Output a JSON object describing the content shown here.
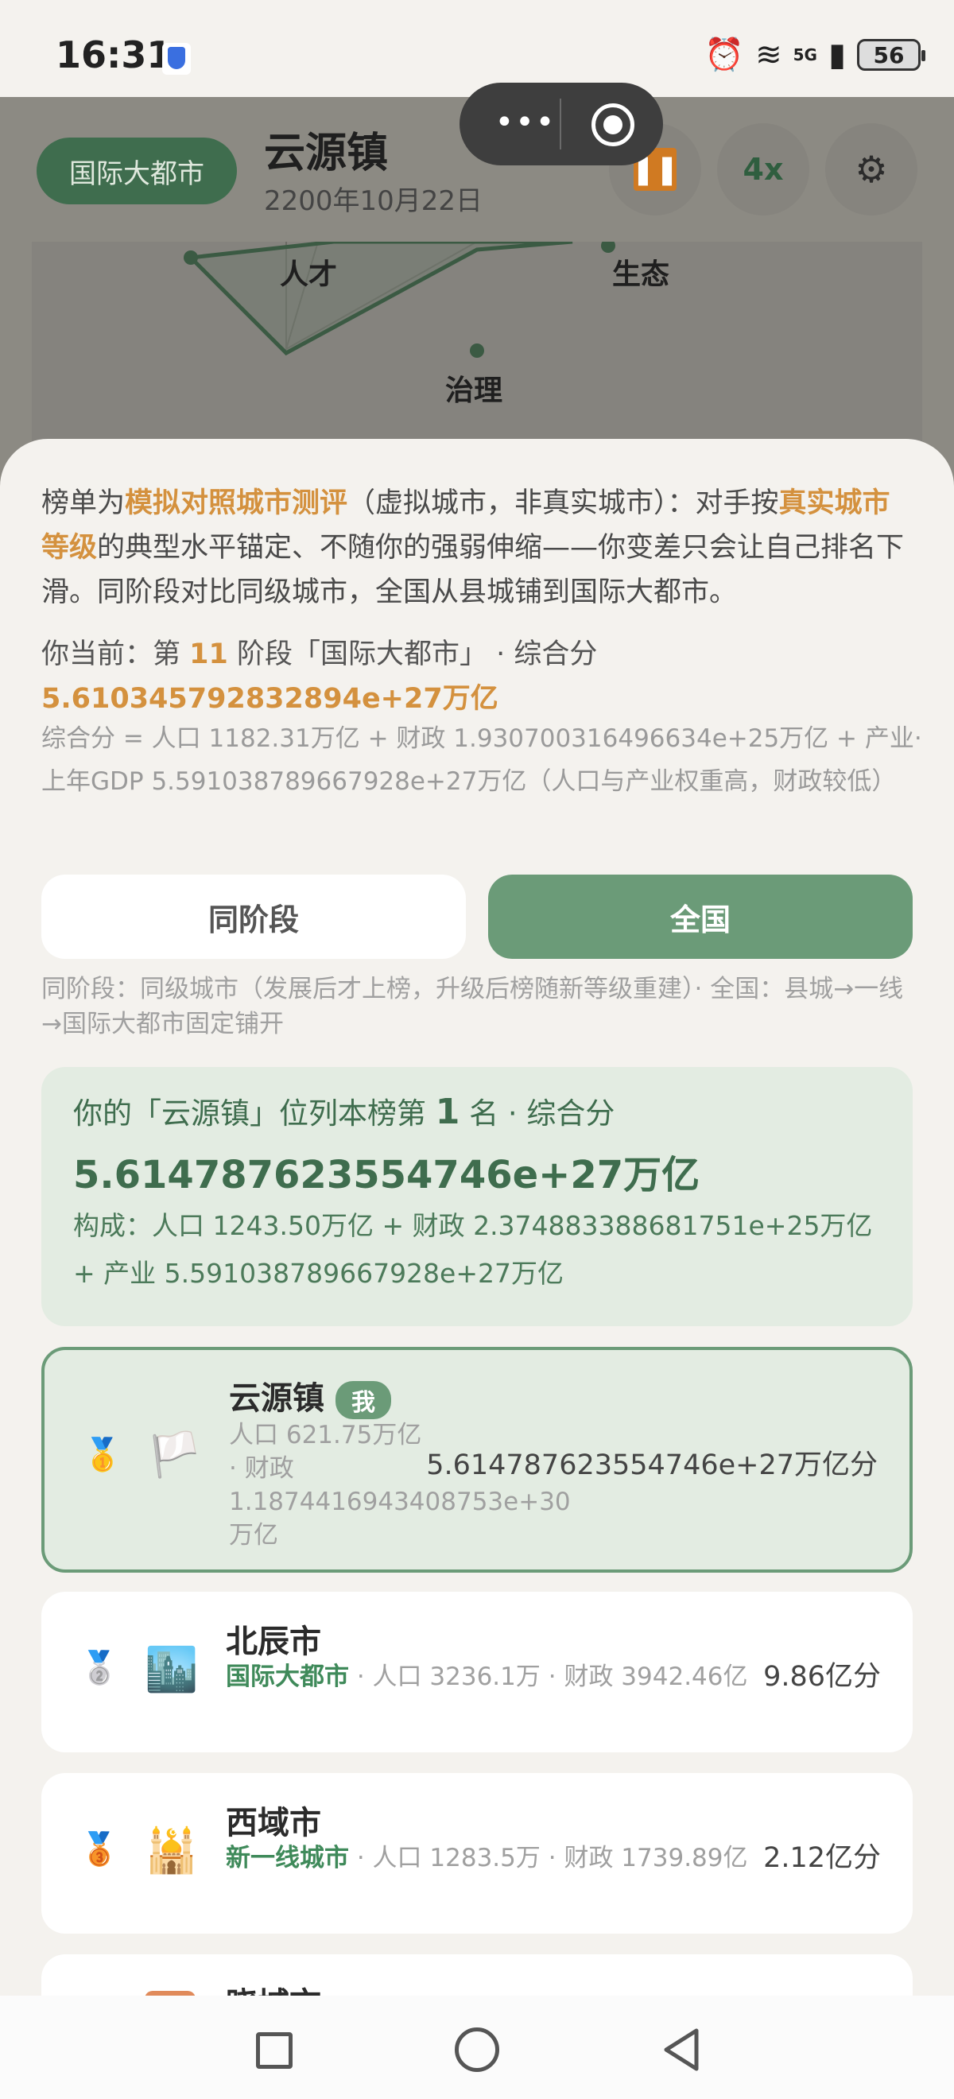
{
  "status": {
    "time": "16:31",
    "network": "5G",
    "battery": "56"
  },
  "header": {
    "city_level_badge": "国际大都市",
    "city_name": "云源镇",
    "date": "2200年10月22日",
    "speed_label": "4x"
  },
  "radar": {
    "labels": {
      "talent": "人才",
      "ecology": "生态",
      "governance": "治理"
    }
  },
  "intro": {
    "t1": "榜单为",
    "h1": "模拟对照城市测评",
    "t2": "（虚拟城市，非真实城市）：对手按",
    "h2": "真实城市等级",
    "t3": "的典型水平锚定、不随你的强弱伸缩——你变差只会让自己排名下滑。同阶段对比同级城市，全国从县城铺到国际大都市。"
  },
  "current": {
    "prefix": "你当前：第 ",
    "stage": "11",
    "suffix": " 阶段「国际大都市」 · 综合分",
    "score": "5.61034579283289​4e+27万亿",
    "formula": "综合分 = 人口 1182.31万亿 + 财政 1.930700316496634e+25万亿 + 产业·上年GDP 5.591038789667928e+27万亿（人口与产业权重高，财政较低）"
  },
  "tabs": {
    "same_stage": "同阶段",
    "national": "全国"
  },
  "tabs_note": "同阶段：同级城市（发展后才上榜，升级后榜随新等级重建）· 全国：县城→一线→国际大都市固定铺开",
  "summary": {
    "prefix": "你的「云源镇」位列本榜第 ",
    "rank": "1",
    "suffix": " 名 · 综合分",
    "score": "5.614787623554746e+27万亿",
    "composition": "构成：人口 1243.50万亿 + 财政 2.374883388681751e+25万亿 + 产业 5.591038789667928e+27万亿"
  },
  "ranking": [
    {
      "medal": "🥇",
      "icon": "🏳️",
      "name": "云源镇",
      "me_tag": "我",
      "detail": "人口 621.75万亿 · 财政 1.1874416943408753e+30万亿",
      "score": "5.614787623554746e+27万亿分"
    },
    {
      "medal": "🥈",
      "icon": "🏙️",
      "name": "北辰市",
      "level": "国际大都市",
      "detail": " · 人口 3236.1万 · 财政 3942.46亿",
      "score": "9.86亿分"
    },
    {
      "medal": "🥉",
      "icon": "🕌",
      "name": "西域市",
      "level": "新一线城市",
      "detail": " · 人口 1283.5万 · 财政 1739.89亿",
      "score": "2.12亿分"
    },
    {
      "name": "晓城市"
    }
  ],
  "colors": {
    "accent": "#6b9b78",
    "highlight": "#d4913e",
    "dark_green": "#3f6d4e"
  }
}
